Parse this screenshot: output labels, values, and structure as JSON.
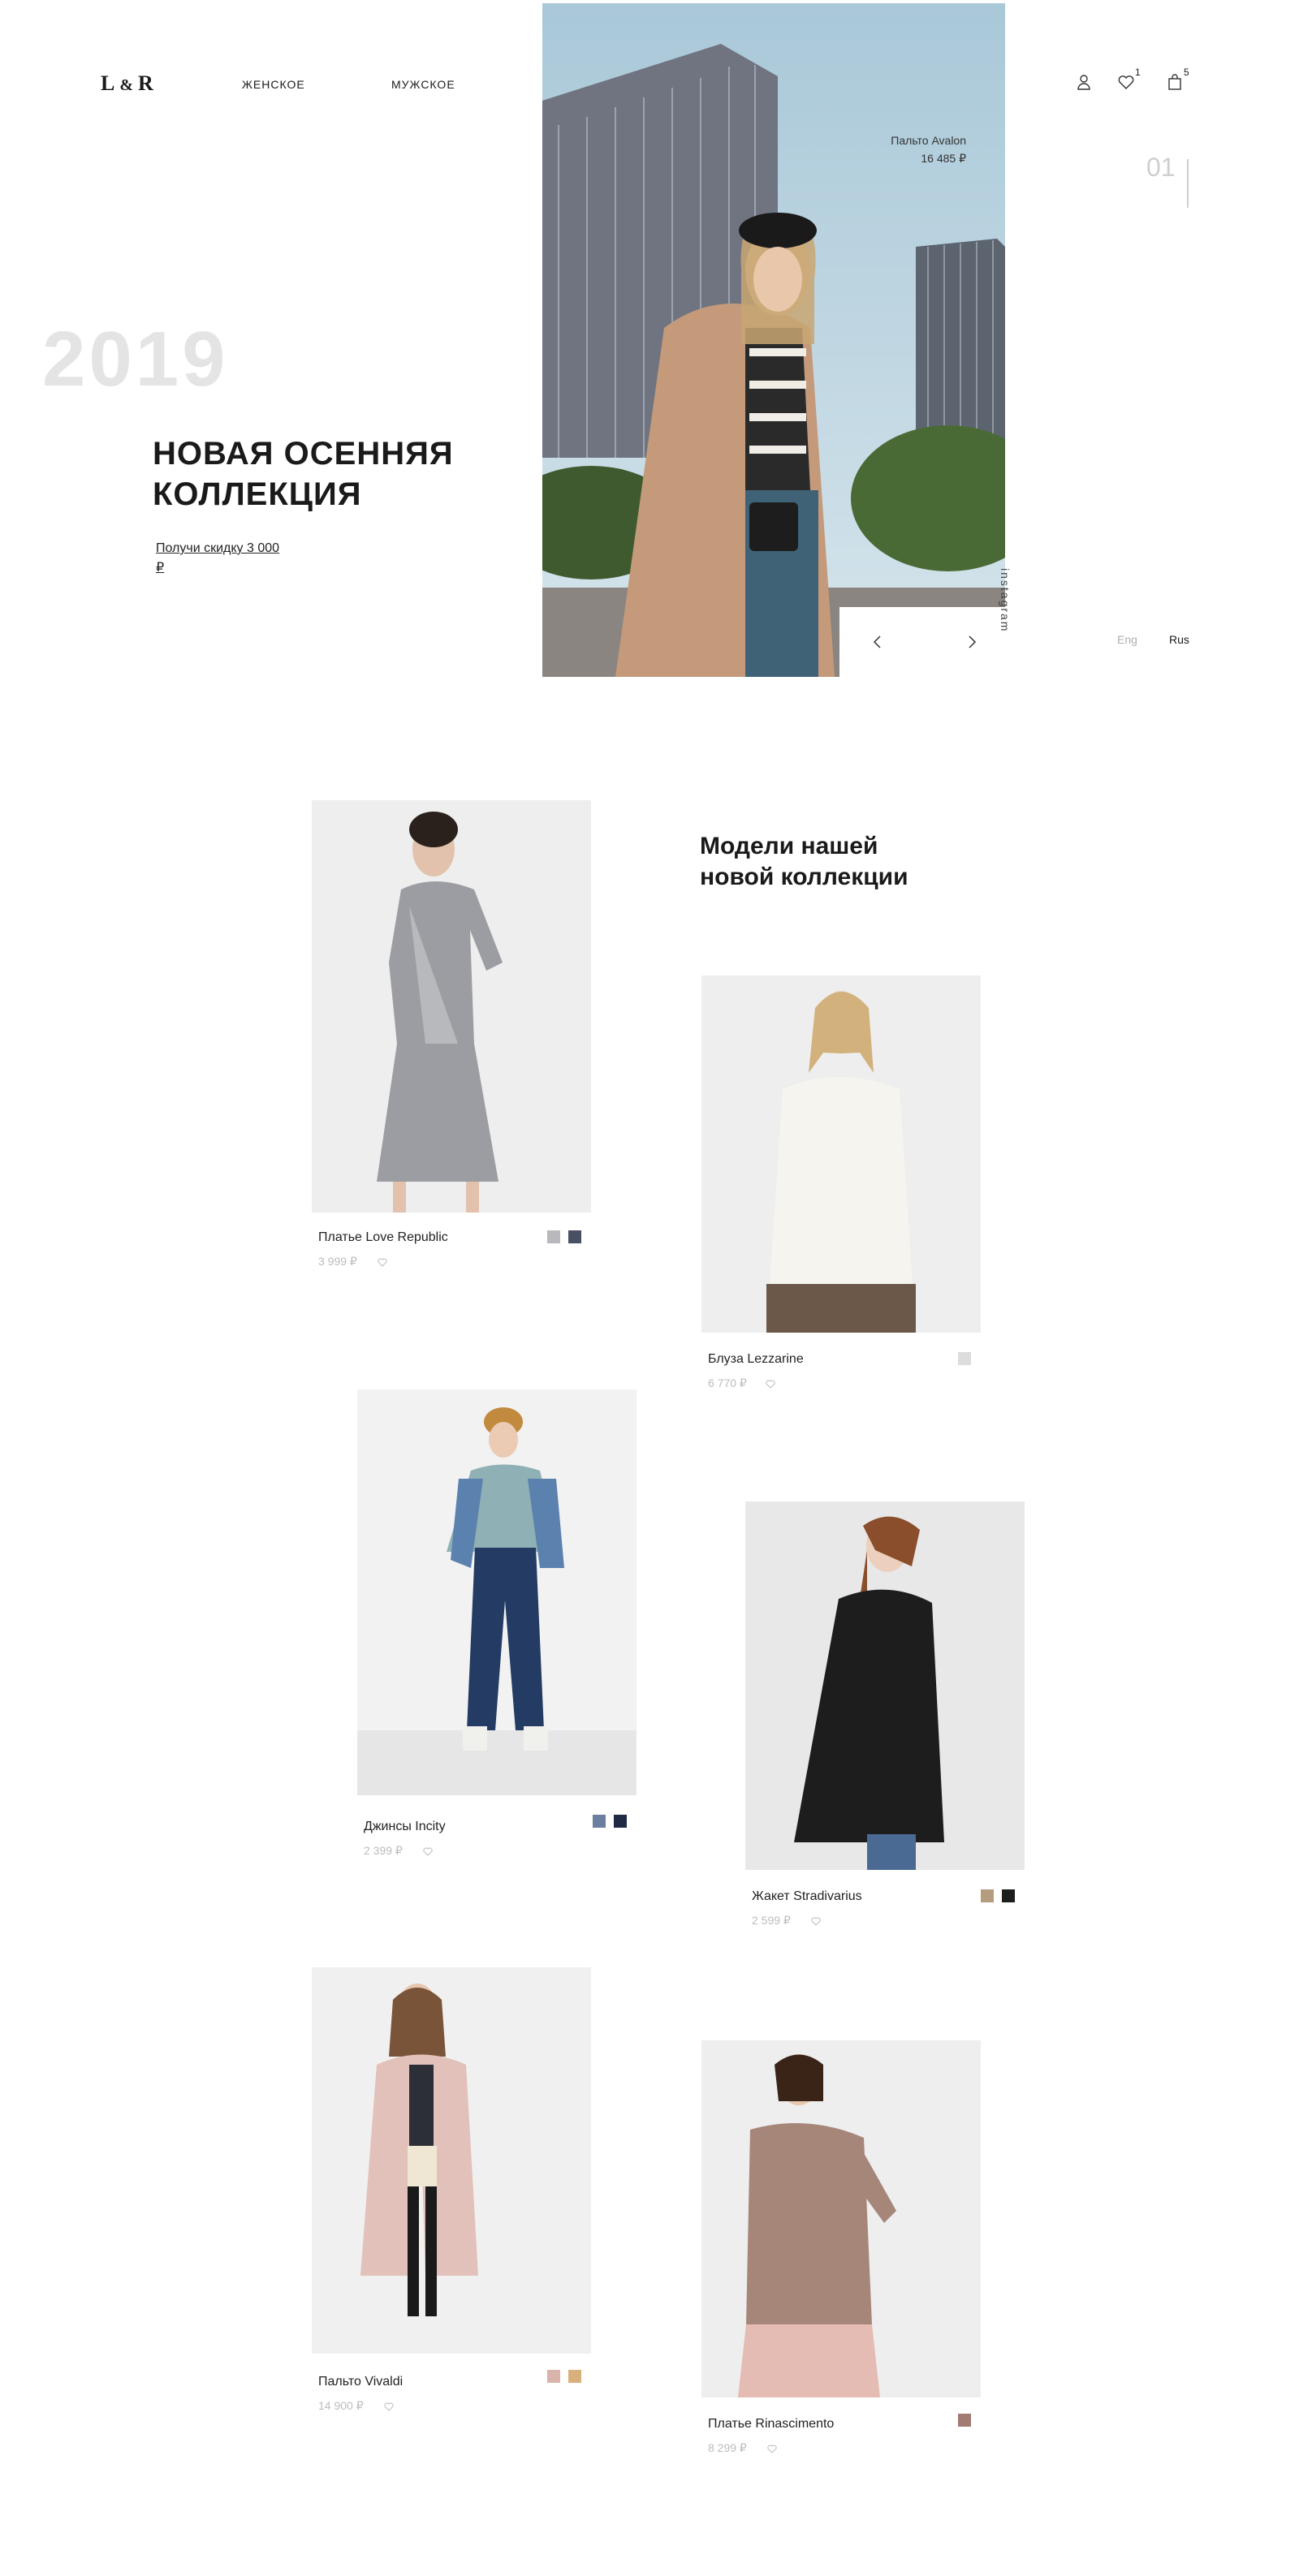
{
  "header": {
    "logo": {
      "left": "L",
      "amp": "&",
      "right": "R"
    },
    "nav": [
      "ЖЕНСКОЕ",
      "МУЖСКОЕ"
    ],
    "wishlist_count": "1",
    "cart_count": "5"
  },
  "hero": {
    "year": "2019",
    "title": "НОВАЯ ОСЕННЯЯ КОЛЛЕКЦИЯ",
    "discount_link": "Получи скидку 3 000 ₽",
    "caption_name": "Пальто Avalon",
    "caption_price": "16 485 ₽",
    "slide_number": "01",
    "instagram": "instagram",
    "languages": [
      "Eng",
      "Rus"
    ],
    "active_language": "Rus"
  },
  "section": {
    "title": "Модели нашей новой коллекции"
  },
  "products": [
    {
      "name": "Платье Love Republic",
      "price": "3 999 ₽",
      "swatches": [
        "#b9b9bd",
        "#4a5063"
      ]
    },
    {
      "name": "Блуза Lezzarine",
      "price": "6 770 ₽",
      "swatches": [
        "#dcdcdc"
      ]
    },
    {
      "name": "Джинсы Incity",
      "price": "2 399 ₽",
      "swatches": [
        "#6a7fa0",
        "#1f2b45"
      ]
    },
    {
      "name": "Жакет Stradivarius",
      "price": "2 599 ₽",
      "swatches": [
        "#b69c7f",
        "#1e1e1e"
      ]
    },
    {
      "name": "Пальто Vivaldi",
      "price": "14 900 ₽",
      "swatches": [
        "#d8b4aa",
        "#d8b07c"
      ]
    },
    {
      "name": "Платье Rinascimento",
      "price": "8 299 ₽",
      "swatches": [
        "#a07c72"
      ]
    }
  ]
}
